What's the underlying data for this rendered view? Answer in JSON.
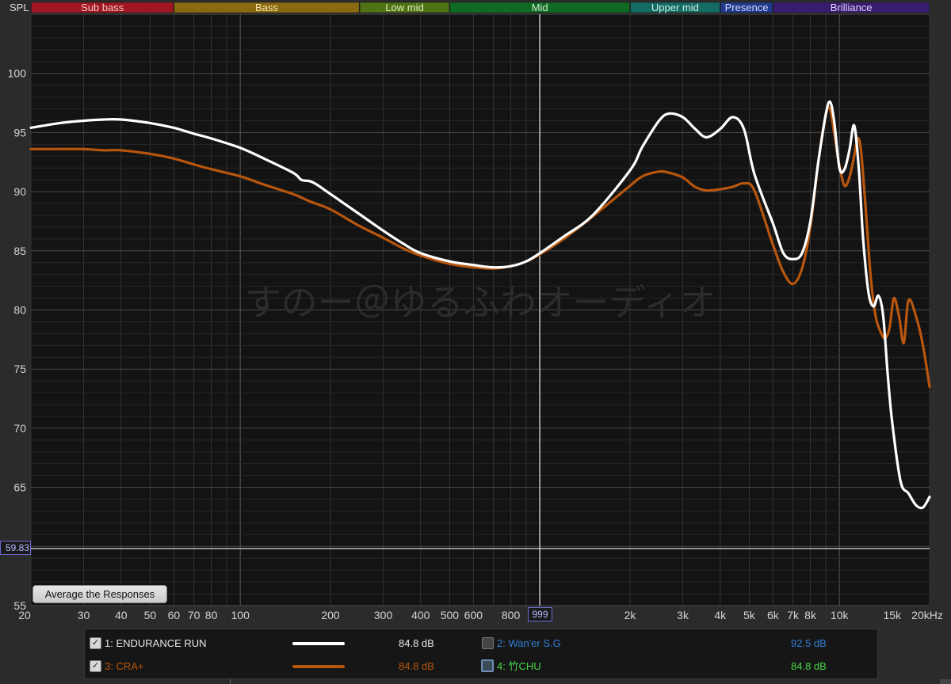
{
  "spl_label": "SPL",
  "bands": [
    {
      "label": "Sub bass",
      "from": 20,
      "to": 60,
      "color": "#a01722",
      "text_color": "#f2c8c8"
    },
    {
      "label": "Bass",
      "from": 60,
      "to": 250,
      "color": "#8a6a10",
      "text_color": "#f6e2a8"
    },
    {
      "label": "Low mid",
      "from": 250,
      "to": 500,
      "color": "#4f7314",
      "text_color": "#dbeec0"
    },
    {
      "label": "Mid",
      "from": 500,
      "to": 2000,
      "color": "#0f6b22",
      "text_color": "#cfeeda"
    },
    {
      "label": "Upper mid",
      "from": 2000,
      "to": 4000,
      "color": "#146b62",
      "text_color": "#cdeee9"
    },
    {
      "label": "Presence",
      "from": 4000,
      "to": 6000,
      "color": "#1f3a8a",
      "text_color": "#d0dcff"
    },
    {
      "label": "Brilliance",
      "from": 6000,
      "to": 20000,
      "color": "#3a1c6e",
      "text_color": "#e1d4ff"
    }
  ],
  "watermark": "すのー＠ゆるふわオーディオ",
  "cursor_readout": "999",
  "reference_readout": "59.83",
  "average_button": "Average the Responses",
  "x_tick_labels": [
    {
      "f": 20,
      "t": "20"
    },
    {
      "f": 30,
      "t": "30"
    },
    {
      "f": 40,
      "t": "40"
    },
    {
      "f": 50,
      "t": "50"
    },
    {
      "f": 60,
      "t": "60"
    },
    {
      "f": 70,
      "t": "70"
    },
    {
      "f": 80,
      "t": "80"
    },
    {
      "f": 100,
      "t": "100"
    },
    {
      "f": 200,
      "t": "200"
    },
    {
      "f": 300,
      "t": "300"
    },
    {
      "f": 400,
      "t": "400"
    },
    {
      "f": 500,
      "t": "500"
    },
    {
      "f": 600,
      "t": "600"
    },
    {
      "f": 800,
      "t": "800"
    },
    {
      "f": 2000,
      "t": "2k"
    },
    {
      "f": 3000,
      "t": "3k"
    },
    {
      "f": 4000,
      "t": "4k"
    },
    {
      "f": 5000,
      "t": "5k"
    },
    {
      "f": 6000,
      "t": "6k"
    },
    {
      "f": 7000,
      "t": "7k"
    },
    {
      "f": 8000,
      "t": "8k"
    },
    {
      "f": 10000,
      "t": "10k"
    },
    {
      "f": 15000,
      "t": "15k"
    },
    {
      "f": 20000,
      "t": "20kHz"
    }
  ],
  "legend": [
    {
      "index_label": "1: ENDURANCE RUN",
      "value": "84.8 dB",
      "checked": true,
      "color": "#ffffff",
      "name_color": "#e8e8e8",
      "line": true
    },
    {
      "index_label": "2: Wan'er S.G",
      "value": "92.5 dB",
      "checked": false,
      "color": "#2f7fd6",
      "name_color": "#2f7fd6",
      "line": false
    },
    {
      "index_label": "3: CRA+",
      "value": "84.8 dB",
      "checked": true,
      "color": "#b8560e",
      "name_color": "#b8560e",
      "line": true
    },
    {
      "index_label": "4: 竹CHU",
      "value": "84.8 dB",
      "checked": false,
      "color": "#47d847",
      "name_color": "#47d847",
      "line": false
    }
  ],
  "chart_data": {
    "type": "line",
    "x_scale": "log",
    "xlim": [
      20,
      20000
    ],
    "ylim": [
      55,
      105
    ],
    "y_ticks": [
      55,
      60,
      65,
      70,
      75,
      80,
      85,
      90,
      95,
      100
    ],
    "y_tick_labels_shown": [
      55,
      65,
      70,
      75,
      80,
      85,
      90,
      95,
      100
    ],
    "cursor_frequency": 999,
    "reference_level": 59.83,
    "grid": true,
    "series": [
      {
        "name": "1: ENDURANCE RUN",
        "color": "#ffffff",
        "x": [
          20,
          25,
          30,
          35,
          40,
          50,
          60,
          70,
          80,
          100,
          120,
          150,
          160,
          170,
          180,
          200,
          250,
          300,
          350,
          400,
          500,
          600,
          700,
          800,
          900,
          1000,
          1200,
          1500,
          2000,
          2200,
          2500,
          2700,
          3000,
          3300,
          3600,
          4000,
          4400,
          4800,
          5200,
          6000,
          6500,
          7000,
          7500,
          8000,
          8500,
          9000,
          9300,
          9600,
          10000,
          10400,
          10800,
          11200,
          11600,
          12000,
          12500,
          13000,
          13500,
          14000,
          14500,
          15000,
          16000,
          17000,
          18000,
          19000,
          20000
        ],
        "y": [
          95.4,
          95.8,
          96.0,
          96.1,
          96.1,
          95.8,
          95.4,
          94.9,
          94.5,
          93.7,
          92.8,
          91.6,
          91.0,
          90.9,
          90.6,
          89.8,
          88.1,
          86.7,
          85.6,
          84.8,
          84.1,
          83.8,
          83.6,
          83.7,
          84.1,
          84.8,
          86.2,
          88.0,
          91.8,
          93.8,
          96.0,
          96.6,
          96.3,
          95.3,
          94.6,
          95.3,
          96.3,
          95.3,
          91.5,
          87.3,
          84.8,
          84.3,
          84.8,
          87.5,
          92.5,
          96.5,
          97.6,
          96.0,
          92.0,
          91.9,
          93.5,
          95.6,
          92.0,
          86.0,
          81.5,
          80.3,
          81.2,
          79.5,
          74.5,
          70.5,
          65.5,
          64.5,
          63.5,
          63.3,
          64.2
        ]
      },
      {
        "name": "3: CRA+",
        "color": "#b8560e",
        "x": [
          20,
          25,
          30,
          35,
          40,
          50,
          60,
          70,
          80,
          100,
          120,
          150,
          170,
          200,
          250,
          300,
          350,
          400,
          500,
          600,
          700,
          800,
          900,
          1000,
          1200,
          1500,
          2000,
          2200,
          2500,
          2700,
          3000,
          3300,
          3600,
          4000,
          4400,
          4800,
          5200,
          6000,
          6500,
          7000,
          7500,
          8000,
          8500,
          9000,
          9300,
          9600,
          10000,
          10400,
          10800,
          11200,
          11500,
          11800,
          12200,
          12700,
          13200,
          13700,
          14200,
          14700,
          15200,
          15800,
          16400,
          17000,
          18000,
          19000,
          20000
        ],
        "y": [
          93.6,
          93.6,
          93.6,
          93.5,
          93.5,
          93.2,
          92.8,
          92.3,
          91.9,
          91.3,
          90.6,
          89.8,
          89.2,
          88.5,
          87.1,
          86.1,
          85.2,
          84.6,
          83.9,
          83.6,
          83.5,
          83.7,
          84.1,
          84.7,
          86.0,
          87.9,
          90.5,
          91.3,
          91.7,
          91.6,
          91.2,
          90.4,
          90.1,
          90.2,
          90.4,
          90.7,
          90.1,
          85.5,
          83.2,
          82.2,
          83.5,
          87.0,
          92.5,
          96.5,
          97.0,
          95.0,
          92.2,
          90.5,
          91.2,
          93.0,
          94.5,
          93.5,
          89.0,
          83.0,
          79.5,
          78.2,
          77.6,
          78.5,
          81.0,
          79.5,
          77.2,
          80.8,
          79.5,
          77.0,
          73.5
        ]
      }
    ]
  }
}
